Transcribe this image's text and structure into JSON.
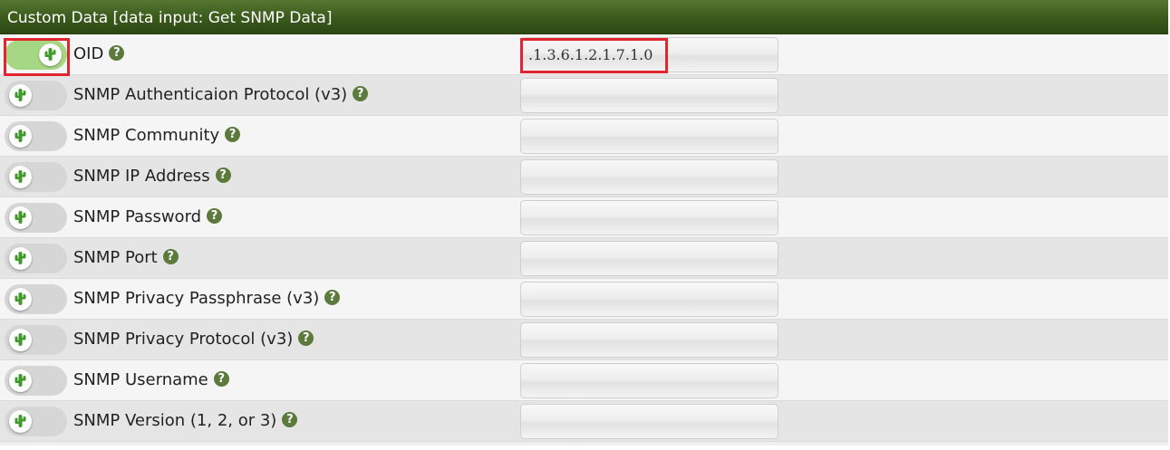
{
  "panel": {
    "title": "Custom Data [data input: Get SNMP Data]",
    "help_glyph": "?",
    "rows": [
      {
        "label": "OID",
        "value": ".1.3.6.1.2.1.7.1.0",
        "toggle_on": true
      },
      {
        "label": "SNMP Authenticaion Protocol (v3)",
        "value": "",
        "toggle_on": false
      },
      {
        "label": "SNMP Community",
        "value": "",
        "toggle_on": false
      },
      {
        "label": "SNMP IP Address",
        "value": "",
        "toggle_on": false
      },
      {
        "label": "SNMP Password",
        "value": "",
        "toggle_on": false
      },
      {
        "label": "SNMP Port",
        "value": "",
        "toggle_on": false
      },
      {
        "label": "SNMP Privacy Passphrase (v3)",
        "value": "",
        "toggle_on": false
      },
      {
        "label": "SNMP Privacy Protocol (v3)",
        "value": "",
        "toggle_on": false
      },
      {
        "label": "SNMP Username",
        "value": "",
        "toggle_on": false
      },
      {
        "label": "SNMP Version (1, 2, or 3)",
        "value": "",
        "toggle_on": false
      }
    ]
  },
  "icons": {
    "toggle_knob": "cactus-icon",
    "help": "help-icon"
  },
  "colors": {
    "header": "#3a5a1c",
    "toggle_on": "#a6d784",
    "toggle_off": "#d6d6d6",
    "help_icon": "#5c7a3c",
    "highlight": "#e0252f"
  }
}
